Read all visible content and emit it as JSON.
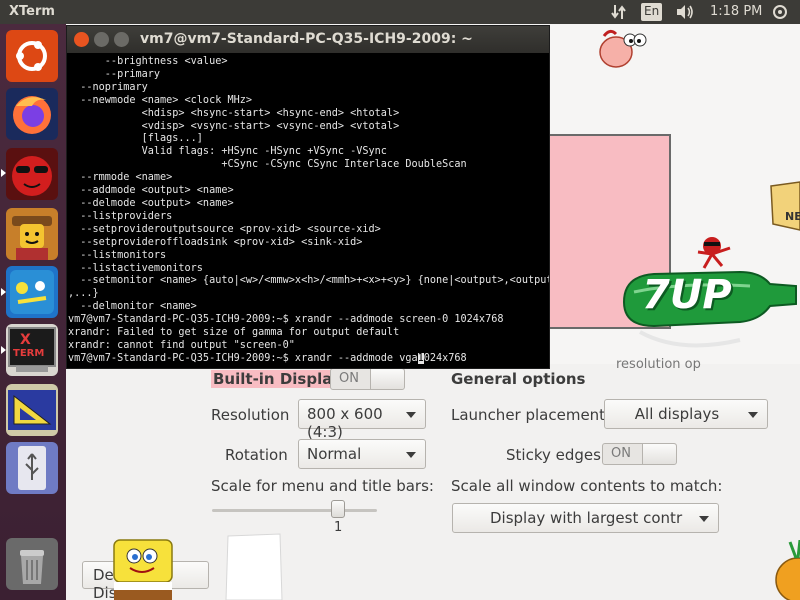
{
  "topbar": {
    "app_name": "XTerm",
    "keyboard_layout": "En",
    "clock": "1:18 PM"
  },
  "launcher": {
    "items": [
      {
        "name": "ubuntu-dash",
        "color": "#dd4814"
      },
      {
        "name": "firefox",
        "color": "#ff7139"
      },
      {
        "name": "app-red-sunglasses",
        "color": "#c81e1e"
      },
      {
        "name": "app-lego-cowboy",
        "color": "#d99a2b"
      },
      {
        "name": "app-blue-sponge",
        "color": "#2a8fd6"
      },
      {
        "name": "xterm",
        "label_x": "X",
        "label_term": "TERM"
      },
      {
        "name": "app-geometry",
        "color": "#3b4bbf"
      },
      {
        "name": "usb-drive",
        "color": "#6f7bc4"
      },
      {
        "name": "trash",
        "color": "#7a7a7a"
      }
    ]
  },
  "settings": {
    "resolution_hint": "resolution op",
    "builtin_display_label": "Built-in Display",
    "builtin_toggle": "ON",
    "general_options_label": "General options",
    "resolution_label": "Resolution",
    "resolution_value": "800 x 600 (4:3)",
    "rotation_label": "Rotation",
    "rotation_value": "Normal",
    "launcher_placement_label": "Launcher placement",
    "launcher_placement_value": "All displays",
    "sticky_edges_label": "Sticky edges",
    "sticky_edges_toggle": "ON",
    "scale_menu_label": "Scale for menu and title bars:",
    "scale_value": "1",
    "scale_all_label": "Scale all window contents to match:",
    "scale_all_value": "Display with largest contr",
    "detect_button": "Detect Displays"
  },
  "xterm": {
    "title": "vm7@vm7-Standard-PC-Q35-ICH9-2009: ~",
    "lines": [
      "      --brightness <value>",
      "      --primary",
      "  --noprimary",
      "  --newmode <name> <clock MHz>",
      "            <hdisp> <hsync-start> <hsync-end> <htotal>",
      "            <vdisp> <vsync-start> <vsync-end> <vtotal>",
      "            [flags...]",
      "            Valid flags: +HSync -HSync +VSync -VSync",
      "                         +CSync -CSync CSync Interlace DoubleScan",
      "  --rmmode <name>",
      "  --addmode <output> <name>",
      "  --delmode <output> <name>",
      "  --listproviders",
      "  --setprovideroutputsource <prov-xid> <source-xid>",
      "  --setprovideroffloadsink <prov-xid> <sink-xid>",
      "  --listmonitors",
      "  --listactivemonitors",
      "  --setmonitor <name> {auto|<w>/<mmw>x<h>/<mmh>+<x>+<y>} {none|<output>,<output>",
      ",...}",
      "  --delmonitor <name>",
      "vm7@vm7-Standard-PC-Q35-ICH9-2009:~$ xrandr --addmode screen-0 1024x768",
      "xrandr: Failed to get size of gamma for output default",
      "xrandr: cannot find output \"screen-0\""
    ],
    "prompt_before_cursor": "vm7@vm7-Standard-PC-Q35-ICH9-2009:~$ xrandr --addmode vga",
    "cursor_char": "1",
    "prompt_after_cursor": "024x768"
  },
  "stickers": {
    "seven_up_text": "7UP",
    "sign_fragment": "NE"
  }
}
